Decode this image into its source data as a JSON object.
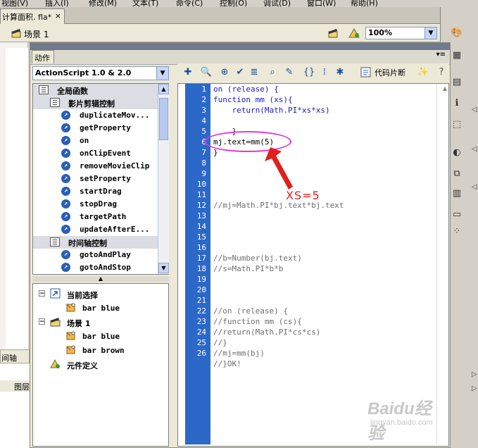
{
  "menubar": {
    "items": [
      "视图(V)",
      "插入(I)",
      "修改(M)",
      "文本(T)",
      "命令(C)",
      "控制(O)",
      "调试(D)",
      "窗口(W)",
      "帮助(H)"
    ]
  },
  "document_tab": {
    "title": "计算面积. fla*",
    "close": "×"
  },
  "scene": {
    "label": "场景 1"
  },
  "zoom": {
    "value": "100%"
  },
  "actions_panel": {
    "title": "动作",
    "menu_glyph": "▾≡"
  },
  "language_select": {
    "value": "ActionScript 1.0 & 2.0"
  },
  "toolbox": {
    "items": [
      {
        "type": "category",
        "indent": 0,
        "label": "全局函数"
      },
      {
        "type": "category",
        "indent": 1,
        "label": "影片剪辑控制"
      },
      {
        "type": "item",
        "label": "duplicateMov..."
      },
      {
        "type": "item",
        "label": "getProperty"
      },
      {
        "type": "item",
        "label": "on"
      },
      {
        "type": "item",
        "label": "onClipEvent"
      },
      {
        "type": "item",
        "label": "removeMovieClip"
      },
      {
        "type": "item",
        "label": "setProperty"
      },
      {
        "type": "item",
        "label": "startDrag"
      },
      {
        "type": "item",
        "label": "stopDrag"
      },
      {
        "type": "item",
        "label": "targetPath"
      },
      {
        "type": "item",
        "label": "updateAfterE..."
      },
      {
        "type": "category",
        "indent": 1,
        "label": "时间轴控制"
      },
      {
        "type": "item",
        "label": "gotoAndPlay"
      },
      {
        "type": "item",
        "label": "gotoAndStop"
      }
    ]
  },
  "script_navigator": {
    "items": [
      {
        "label": "当前选择",
        "level": 0,
        "toggle": "−",
        "icon": "selection-icon"
      },
      {
        "label": "bar blue",
        "level": 1,
        "toggle": "",
        "icon": "button-symbol-icon"
      },
      {
        "label": "场景 1",
        "level": 0,
        "toggle": "−",
        "icon": "scene-icon"
      },
      {
        "label": "bar blue",
        "level": 1,
        "toggle": "",
        "icon": "button-symbol-icon"
      },
      {
        "label": "bar brown",
        "level": 1,
        "toggle": "",
        "icon": "button-symbol-icon"
      },
      {
        "label": "元件定义",
        "level": 0,
        "toggle": "",
        "icon": "symbol-definitions-icon"
      }
    ]
  },
  "code_toolbar": {
    "snippet_label": "代码片断"
  },
  "code": {
    "lines": [
      {
        "n": "1",
        "text": "on (release) {",
        "style": "kw"
      },
      {
        "n": "2",
        "text": "function mm (xs){",
        "style": "kw"
      },
      {
        "n": "3",
        "text": "    return(Math.PI*xs*xs)",
        "style": "kw"
      },
      {
        "n": "4",
        "text": "",
        "style": ""
      },
      {
        "n": "5",
        "text": "    }",
        "style": ""
      },
      {
        "n": "6",
        "text": "mj.text=mm(5)",
        "style": ""
      },
      {
        "n": "7",
        "text": "}",
        "style": ""
      },
      {
        "n": "8",
        "text": "",
        "style": ""
      },
      {
        "n": "9",
        "text": "",
        "style": ""
      },
      {
        "n": "10",
        "text": "",
        "style": ""
      },
      {
        "n": "11",
        "text": "",
        "style": ""
      },
      {
        "n": "12",
        "text": "//mj=Math.PI*bj.text*bj.text",
        "style": "cm"
      },
      {
        "n": "13",
        "text": "",
        "style": ""
      },
      {
        "n": "14",
        "text": "",
        "style": ""
      },
      {
        "n": "15",
        "text": "",
        "style": ""
      },
      {
        "n": "16",
        "text": "",
        "style": ""
      },
      {
        "n": "17",
        "text": "//b=Number(bj.text)",
        "style": "cm"
      },
      {
        "n": "18",
        "text": "//s=Math.PI*b*b",
        "style": "cm"
      },
      {
        "n": "19",
        "text": "",
        "style": ""
      },
      {
        "n": "20",
        "text": "",
        "style": ""
      },
      {
        "n": "21",
        "text": "",
        "style": ""
      },
      {
        "n": "22",
        "text": "//on (release) {",
        "style": "cm"
      },
      {
        "n": "23",
        "text": "//function mm (cs){",
        "style": "cm"
      },
      {
        "n": "24",
        "text": "//return(Math.PI*cs*cs)",
        "style": "cm"
      },
      {
        "n": "25",
        "text": "//}",
        "style": "cm"
      },
      {
        "n": "26",
        "text": "//mj=mm(bj)",
        "style": "cm"
      },
      {
        "n": "",
        "text": "//}OK!",
        "style": "cm"
      }
    ]
  },
  "annotation": {
    "text": "XS=5",
    "color": "#e11f1f",
    "ellipse_color": "#e23ad0"
  },
  "watermark": {
    "main": "Baidu经验",
    "sub": "jingyan.baidu.com"
  },
  "timeline": {
    "tab_label": "间轴",
    "layer_label": "图层"
  },
  "colors": {
    "gutter": "#2c68c8",
    "keyword": "#1818c8",
    "comment": "#6e6e6e"
  }
}
